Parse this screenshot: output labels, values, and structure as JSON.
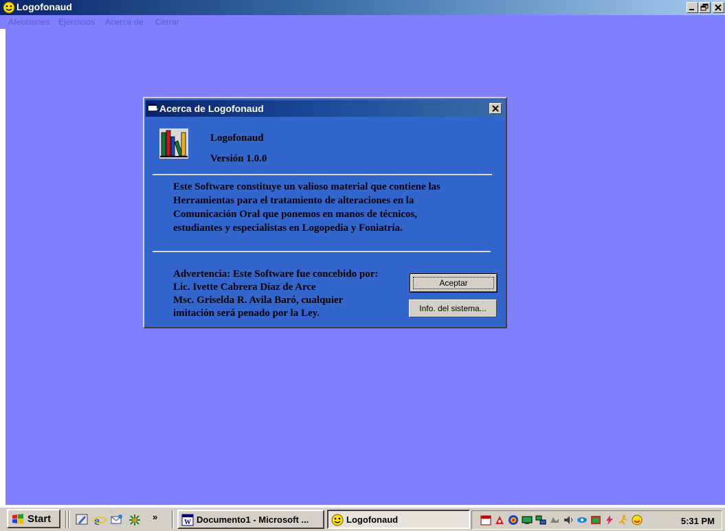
{
  "window": {
    "title": "Logofonaud"
  },
  "menu": {
    "items": [
      "Afecciones",
      "Ejercicios",
      "Acerca de",
      "Cerrar"
    ]
  },
  "dialog": {
    "title": "Acerca de Logofonaud",
    "product_name": "Logofonaud",
    "version": "Versión 1.0.0",
    "description": [
      "Este Software constituye un valioso material que contiene las",
      "Herramientas para el tratamiento de alteraciones en la",
      "Comunicación Oral que ponemos en manos de técnicos,",
      "estudiantes y especialistas en Logopedia y Foniatría."
    ],
    "warning": [
      "Advertencia: Este Software fue concebido por:",
      "Lic. Ivette Cabrera Díaz de Arce",
      "Msc. Griselda R. Avila Baró, cualquier",
      "imitación será penado por la Ley."
    ],
    "ok_label": "Aceptar",
    "sysinfo_label": "Info. del sistema..."
  },
  "taskbar": {
    "start_label": "Start",
    "chevron": "»",
    "tasks": [
      {
        "label": "Documento1 - Microsoft ...",
        "icon": "word-icon"
      },
      {
        "label": "Logofonaud",
        "icon": "smiley-icon"
      }
    ],
    "clock": "5:31 PM"
  },
  "colors": {
    "desktop": "#8080ff",
    "dialog_body": "#3366cc",
    "menu_text": "#5a5ac8"
  }
}
